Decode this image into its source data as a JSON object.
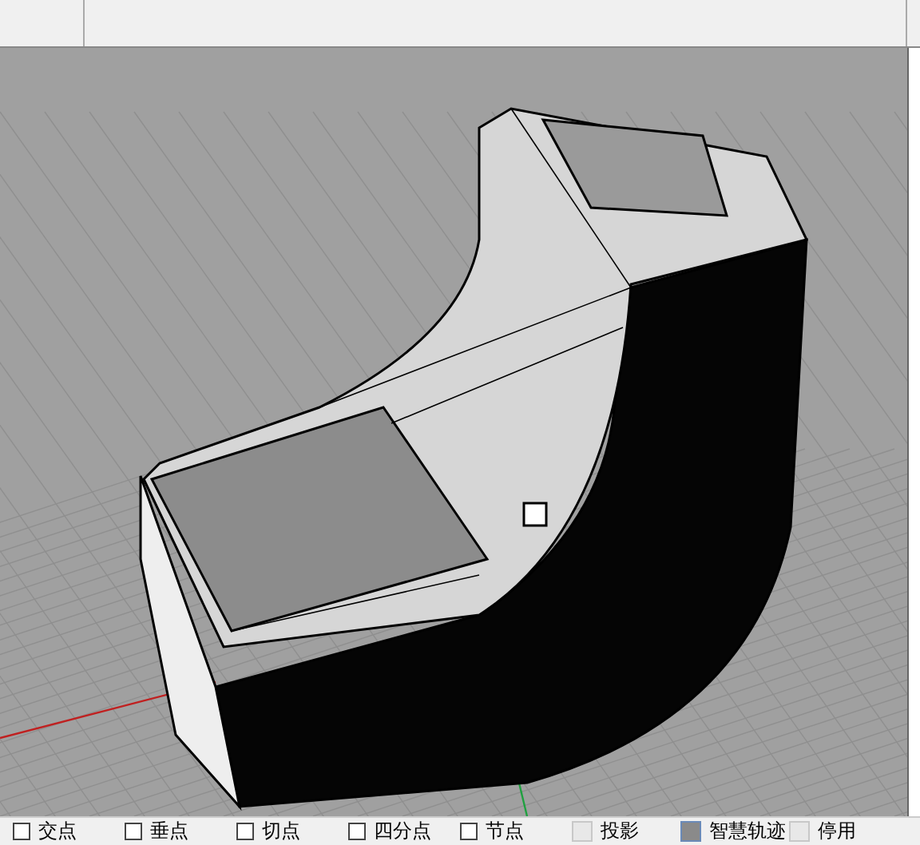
{
  "osnap_bar": {
    "items": [
      {
        "label": "交点",
        "kind": "checkbox",
        "checked": false
      },
      {
        "label": "垂点",
        "kind": "checkbox",
        "checked": false
      },
      {
        "label": "切点",
        "kind": "checkbox",
        "checked": false
      },
      {
        "label": "四分点",
        "kind": "checkbox",
        "checked": false
      },
      {
        "label": "节点",
        "kind": "checkbox",
        "checked": false
      },
      {
        "label": "投影",
        "kind": "toggle",
        "checked": false
      },
      {
        "label": "智慧轨迹",
        "kind": "toggle",
        "checked": true
      },
      {
        "label": "停用",
        "kind": "toggle",
        "checked": false
      }
    ]
  }
}
